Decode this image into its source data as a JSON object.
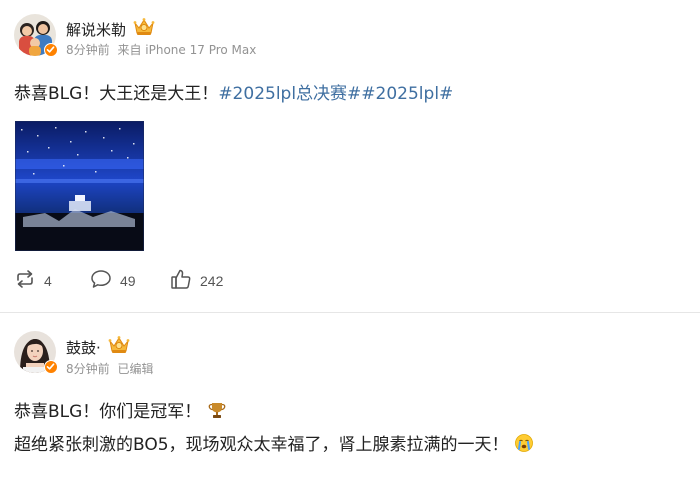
{
  "post1": {
    "username": "解说米勒",
    "time": "8分钟前",
    "source": "来自 iPhone 17 Pro Max",
    "text_prefix": "恭喜BLG！大王还是大王！",
    "hashtags": "#2025lpl总决赛##2025lpl#",
    "reposts": "4",
    "comments": "49",
    "likes": "242"
  },
  "post2": {
    "username": "鼓鼓·",
    "time": "8分钟前",
    "edited": "已编辑",
    "line1": "恭喜BLG！你们是冠军！",
    "line2": "超绝紧张刺激的BO5，现场观众太幸福了，肾上腺素拉满的一天！"
  },
  "icons": {
    "verified": "verified-badge-icon",
    "crown": "crown-badge-icon",
    "repost": "repost-icon",
    "comment": "comment-icon",
    "like": "like-icon",
    "trophy": "trophy-emoji-icon",
    "crying": "crying-emoji-icon"
  },
  "colors": {
    "hashtag": "#3f6fa1",
    "verified": "#ff8200",
    "meta": "#939393"
  }
}
